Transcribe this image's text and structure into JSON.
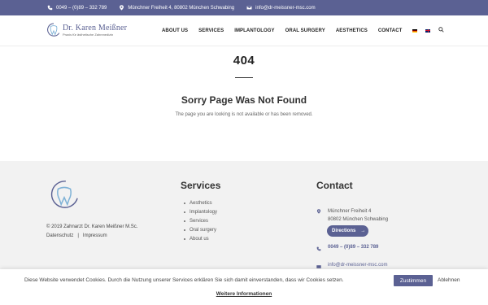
{
  "colors": {
    "accent": "#5b6193",
    "footer_bg": "#f2f2f2",
    "topbar_bg": "#5b6193"
  },
  "topbar": {
    "phone": "0049 – (0)89 – 332 789",
    "address": "Münchner Freiheit 4, 80802 München Schwabing",
    "email": "info@dr-meissner-msc.com",
    "icons": [
      "phone-icon",
      "map-pin-icon",
      "envelope-icon"
    ]
  },
  "logo": {
    "name": "Dr. Karen Meißner",
    "tagline": "Praxis für ästhetische Zahnmedizin"
  },
  "nav": {
    "items": [
      "ABOUT US",
      "SERVICES",
      "IMPLANTOLOGY",
      "ORAL SURGERY",
      "AESTHETICS",
      "CONTACT"
    ],
    "languages": [
      "de",
      "en"
    ]
  },
  "error": {
    "code": "404",
    "title": "Sorry Page Was Not Found",
    "text": "The page you are looking is not available or has been removed."
  },
  "footer": {
    "copyright": "© 2019  Zahnarzt Dr. Karen Meißner M.Sc.",
    "links": [
      "Datenschutz",
      "Impressum"
    ],
    "separator": "|",
    "services_title": "Services",
    "services": [
      "Aesthetics",
      "Implantology",
      "Services",
      "Oral surgery",
      "About us"
    ],
    "contact_title": "Contact",
    "address_line1": "Münchner Freiheit 4",
    "address_line2": "80802 München Schwabing",
    "directions": "Directions",
    "directions_arrow": "→",
    "phone": "0049 – (0)89 – 332 789",
    "email": "info@dr-meissner-msc.com"
  },
  "cookie": {
    "text": "Diese Website verwendet Cookies. Durch die Nutzung unserer Services erklären Sie sich damit einverstanden, dass wir Cookies setzen.",
    "accept": "Zustimmen",
    "reject": "Ablehnen",
    "more": "Weitere Informationen"
  }
}
